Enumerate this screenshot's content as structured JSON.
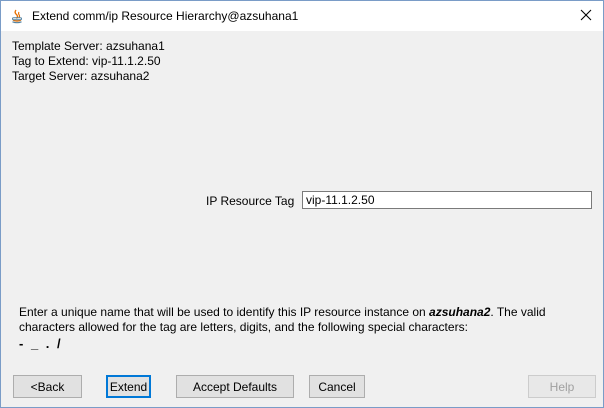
{
  "window": {
    "title": "Extend comm/ip Resource Hierarchy@azsuhana1"
  },
  "info": {
    "template_server": "Template Server: azsuhana1",
    "tag_to_extend": "Tag to Extend: vip-11.1.2.50",
    "target_server": "Target Server: azsuhana2"
  },
  "form": {
    "label": "IP Resource Tag",
    "value": "vip-11.1.2.50"
  },
  "help": {
    "prefix": "Enter a unique name that will be used to identify this IP resource instance on ",
    "server": "azsuhana2",
    "suffix": ". The valid characters allowed for the tag are letters, digits, and the following special characters:",
    "special_chars": "- _ . /"
  },
  "buttons": {
    "back": "<Back",
    "extend": "Extend",
    "accept_defaults": "Accept Defaults",
    "cancel": "Cancel",
    "help": "Help"
  },
  "colors": {
    "background": "#f0f0f0",
    "titlebar": "#ffffff",
    "focus": "#0078d7",
    "disabled_text": "#a0a0a0"
  }
}
